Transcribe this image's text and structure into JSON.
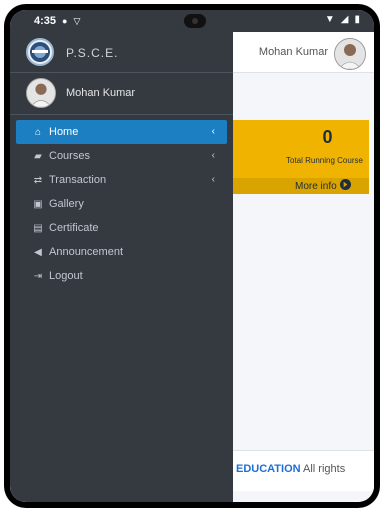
{
  "status": {
    "time": "4:35"
  },
  "topnav": {
    "user_name": "Mohan Kumar"
  },
  "sidebar": {
    "brand": "P.S.C.E.",
    "user": "Mohan Kumar",
    "items": [
      {
        "label": "Home",
        "icon": "home-icon",
        "active": true,
        "chevron": "‹"
      },
      {
        "label": "Courses",
        "icon": "book-icon",
        "chevron": "‹"
      },
      {
        "label": "Transaction",
        "icon": "exchange-icon",
        "chevron": "‹"
      },
      {
        "label": "Gallery",
        "icon": "image-icon"
      },
      {
        "label": "Certificate",
        "icon": "certificate-icon"
      },
      {
        "label": "Announcement",
        "icon": "megaphone-icon"
      },
      {
        "label": "Logout",
        "icon": "logout-icon"
      }
    ]
  },
  "card": {
    "count": "0",
    "label": "Total Running Course",
    "more": "More info"
  },
  "footer": {
    "brand": "EDUCATION",
    "rest": "All rights"
  },
  "colors": {
    "sidebar": "#343a40",
    "active": "#1c7fc1",
    "card": "#f0b400",
    "link": "#1d6fd6"
  }
}
